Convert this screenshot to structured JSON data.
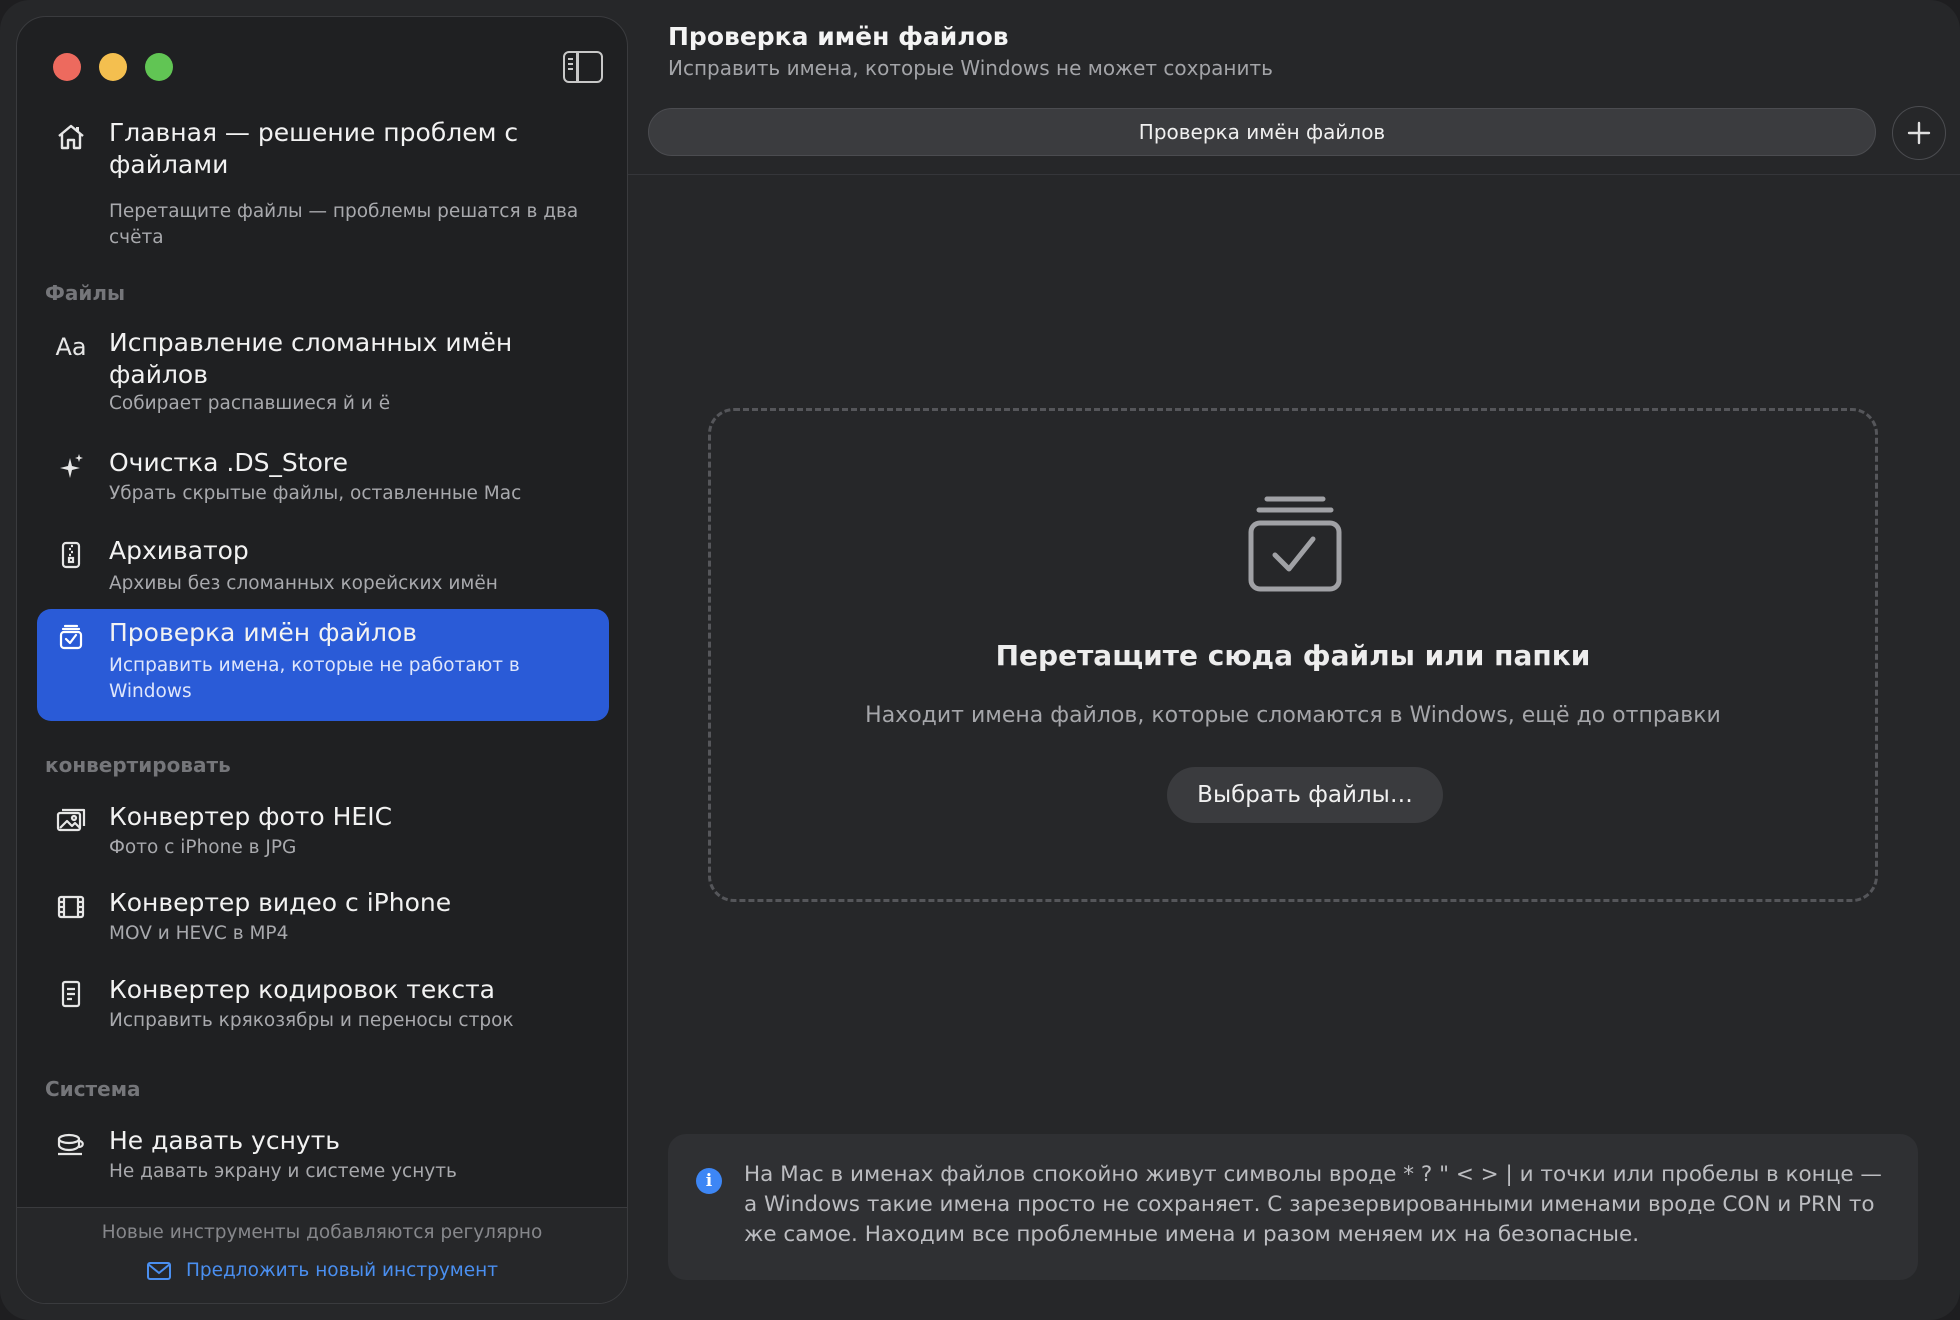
{
  "header": {
    "title": "Проверка имён файлов",
    "subtitle": "Исправить имена, которые Windows не может сохранить"
  },
  "tabs": [
    {
      "label": "Проверка имён файлов"
    }
  ],
  "sidebar": {
    "home": {
      "title": "Главная — решение проблем с файлами",
      "subtitle": "Перетащите файлы — проблемы решатся в два счёта",
      "icon": "house-icon"
    },
    "sections": [
      {
        "title": "Файлы",
        "items": [
          {
            "title": "Исправление сломанных имён файлов",
            "subtitle": "Собирает распавшиеся й и ё",
            "icon": "text-format-icon"
          },
          {
            "title": "Очистка .DS_Store",
            "subtitle": "Убрать скрытые файлы, оставленные Mac",
            "icon": "sparkles-icon"
          },
          {
            "title": "Архиватор",
            "subtitle": "Архивы без сломанных корейских имён",
            "icon": "zipper-page-icon"
          },
          {
            "title": "Проверка имён файлов",
            "subtitle": "Исправить имена, которые не работают в Windows",
            "icon": "tray-checkmark-icon",
            "active": true
          }
        ]
      },
      {
        "title": "конвертировать",
        "items": [
          {
            "title": "Конвертер фото HEIC",
            "subtitle": "Фото с iPhone в JPG",
            "icon": "photos-icon"
          },
          {
            "title": "Конвертер видео с iPhone",
            "subtitle": "MOV и HEVC в MP4",
            "icon": "film-icon"
          },
          {
            "title": "Конвертер кодировок текста",
            "subtitle": "Исправить крякозябры и переносы строк",
            "icon": "doc-text-icon"
          }
        ]
      },
      {
        "title": "Система",
        "items": [
          {
            "title": "Не давать уснуть",
            "subtitle": "Не давать экрану и системе уснуть",
            "icon": "cup-icon"
          }
        ]
      }
    ],
    "footer": {
      "note": "Новые инструменты добавляются регулярно",
      "link": "Предложить новый инструмент",
      "link_icon": "envelope-icon"
    }
  },
  "dropzone": {
    "title": "Перетащите сюда файлы или папки",
    "subtitle": "Находит имена файлов, которые сломаются в Windows, ещё до отправки",
    "button": "Выбрать файлы…",
    "icon": "tray-checkmark-icon"
  },
  "info": {
    "text": "На Mac в именах файлов спокойно живут символы вроде * ? \" < > | и точки или пробелы в конце — а Windows такие имена просто не сохраняет. С зарезервированными именами вроде CON и PRN то же самое. Находим все проблемные имена и разом меняем их на безопасные.",
    "icon": "info-icon"
  },
  "colors": {
    "accent": "#2a5bd7",
    "link": "#4a8ff0",
    "info": "#3d86f5",
    "close": "#ed6a5e",
    "minimize": "#f4bf4f",
    "zoom": "#61c554"
  }
}
